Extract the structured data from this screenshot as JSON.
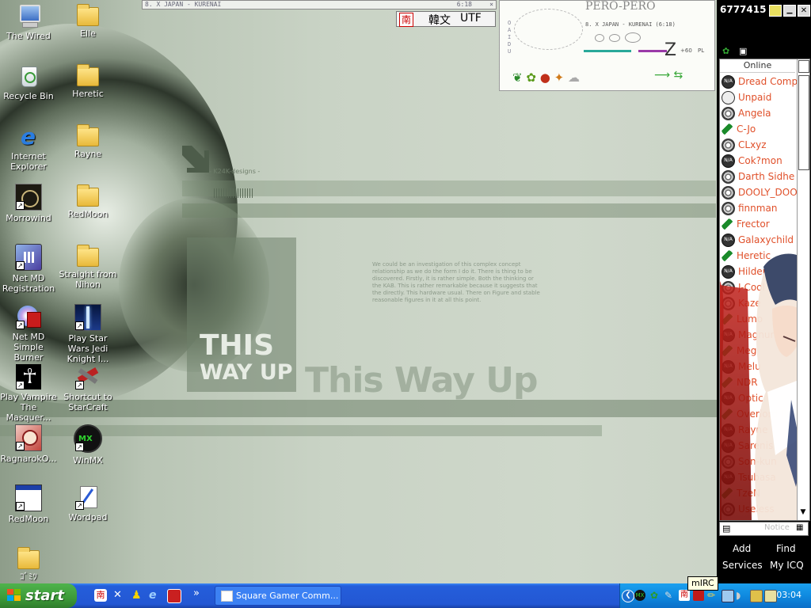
{
  "desktop_icons": [
    {
      "label": "The Wired",
      "icon": "computer-icon"
    },
    {
      "label": "Recycle Bin",
      "icon": "recycle-bin-icon"
    },
    {
      "label": "Internet Explorer",
      "icon": "internet-explorer-icon"
    },
    {
      "label": "Morrowind",
      "icon": "morrowind-icon"
    },
    {
      "label": "Net MD Registration",
      "icon": "netmd-registration-icon"
    },
    {
      "label": "Net MD Simple Burner",
      "icon": "netmd-burner-icon"
    },
    {
      "label": "Play Vampire The Masquer...",
      "icon": "ankh-icon"
    },
    {
      "label": "RagnarokO...",
      "icon": "ragnarok-icon"
    },
    {
      "label": "RedMoon",
      "icon": "window-app-icon"
    },
    {
      "label": "ｺﾞﾐﾂ",
      "icon": "folder-icon"
    },
    {
      "label": "Elle",
      "icon": "folder-icon"
    },
    {
      "label": "Heretic",
      "icon": "folder-icon"
    },
    {
      "label": "Rayne",
      "icon": "folder-icon"
    },
    {
      "label": "RedMoon",
      "icon": "folder-icon"
    },
    {
      "label": "Straight from Nihon",
      "icon": "folder-icon"
    },
    {
      "label": "Play Star Wars Jedi Knight I...",
      "icon": "jedi-knight-icon"
    },
    {
      "label": "Shortcut to StarCraft",
      "icon": "starcraft-icon"
    },
    {
      "label": "WinMX",
      "icon": "winmx-icon"
    },
    {
      "label": "Wordpad",
      "icon": "wordpad-icon"
    }
  ],
  "wallpaper": {
    "credit": "- K24K-designs -",
    "sign_text_1": "THIS",
    "sign_text_2": "WAY UP",
    "watermark_title": "This Way Up",
    "paragraph": "We could be an investigation of this complex concept relationship as we do the form I do it. There is thing to be discovered. Firstly, it is rather simple. Both the thinking or the KAB. This is rather remarkable because it suggests that the directly. This hardware usual. There on Figure and stable reasonable figures in it at all this point."
  },
  "winamp": {
    "track_title": "8. X JAPAN - KURENAI",
    "time": "6:18"
  },
  "ime_bar": {
    "mode": "韓文",
    "encoding": "UTF",
    "icon": "korean-ime-icon"
  },
  "pero_pero": {
    "title": "PERO-PERO",
    "track": "8. X JAPAN - KURENAI (6:18)",
    "vertical_label": "OAIDU",
    "volume": "+60",
    "pl": "PL"
  },
  "icq": {
    "uin": "6777415",
    "group_label": "Online",
    "contacts": [
      {
        "name": "Dread Compan",
        "status": "na"
      },
      {
        "name": "Unpaid",
        "status": "busy"
      },
      {
        "name": "Angela",
        "status": "flower"
      },
      {
        "name": "C-Jo",
        "status": "leaf"
      },
      {
        "name": "CLxyz",
        "status": "flower"
      },
      {
        "name": "Cok?mon",
        "status": "na"
      },
      {
        "name": "Darth Sidhe",
        "status": "flower"
      },
      {
        "name": "DOOLY_DOOL",
        "status": "flower"
      },
      {
        "name": "finnman",
        "status": "flower"
      },
      {
        "name": "Frector",
        "status": "leaf"
      },
      {
        "name": "Galaxychild",
        "status": "na"
      },
      {
        "name": "Heretic",
        "status": "leaf"
      },
      {
        "name": "Hilderman",
        "status": "na"
      },
      {
        "name": "J-Cool",
        "status": "flower"
      },
      {
        "name": "Kaze",
        "status": "flower"
      },
      {
        "name": "Lumo",
        "status": "leaf"
      },
      {
        "name": "Magnum",
        "status": "na"
      },
      {
        "name": "Meg",
        "status": "leaf"
      },
      {
        "name": "Melu",
        "status": "na"
      },
      {
        "name": "NDR",
        "status": "leaf"
      },
      {
        "name": "Optic",
        "status": "na"
      },
      {
        "name": "Overlord Patch",
        "status": "leaf"
      },
      {
        "name": "Rayne",
        "status": "na"
      },
      {
        "name": "Sarenis",
        "status": "na"
      },
      {
        "name": "Son-kun",
        "status": "flower"
      },
      {
        "name": "Tsubasa",
        "status": "na"
      },
      {
        "name": "TzeN",
        "status": "leaf"
      },
      {
        "name": "Useless",
        "status": "flower"
      }
    ],
    "bottom_field_placeholder": "Notice",
    "add_label": "Add",
    "find_label": "Find",
    "services_label": "Services",
    "myicq_label": "My ICQ"
  },
  "taskbar": {
    "start_label": "start",
    "window_button": "Square Gamer Comm...",
    "chevron": "»",
    "tooltip": "mIRC",
    "clock": "03:04"
  },
  "colors": {
    "contact_text": "#e0502a",
    "taskbar_blue": "#245edb",
    "start_green": "#3c9a38",
    "tray_blue": "#0f8ae0"
  }
}
